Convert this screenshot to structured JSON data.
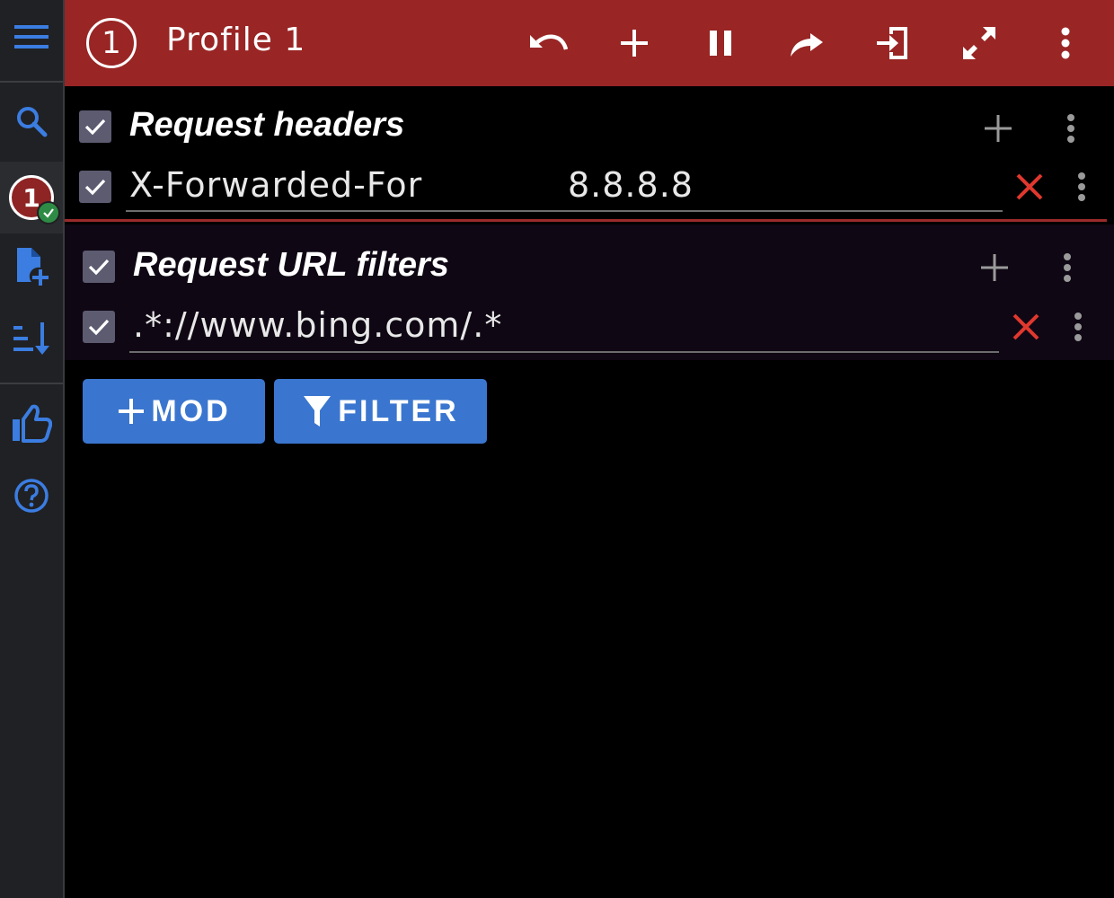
{
  "header": {
    "profile_number": "1",
    "title": "Profile 1",
    "actions": [
      "undo-icon",
      "add-icon",
      "pause-icon",
      "redo-icon",
      "import-icon",
      "fullscreen-icon",
      "more-vert-icon"
    ]
  },
  "sidebar": {
    "items": [
      "menu-icon",
      "search-icon",
      "profile-badge",
      "new-file-icon",
      "sort-icon",
      "thumb-up-icon",
      "help-icon"
    ],
    "active_profile_number": "1",
    "accent": "#3b7de1"
  },
  "request_headers": {
    "title": "Request headers",
    "enabled": true,
    "rows": [
      {
        "enabled": true,
        "name": "X-Forwarded-For",
        "value": "8.8.8.8"
      }
    ]
  },
  "request_url_filters": {
    "title": "Request URL filters",
    "enabled": true,
    "rows": [
      {
        "enabled": true,
        "pattern": ".*://www.bing.com/.*"
      }
    ]
  },
  "buttons": {
    "mod_label": "MOD",
    "filter_label": "FILTER"
  },
  "colors": {
    "header_bg": "#992525",
    "button_bg": "#3a76cf",
    "delete": "#e0382e"
  }
}
